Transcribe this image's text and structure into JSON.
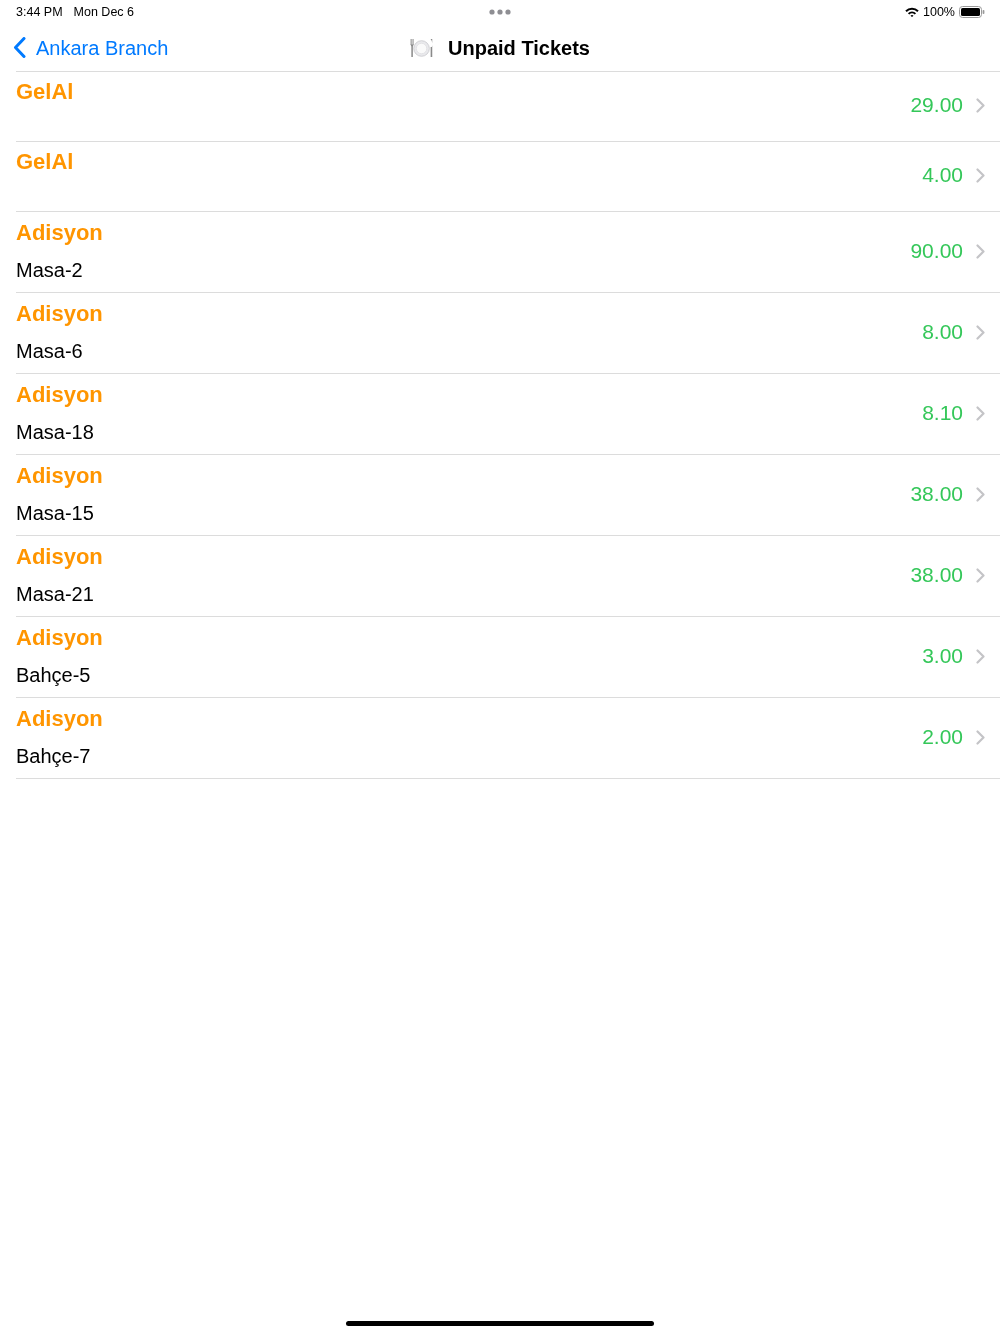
{
  "status_bar": {
    "time": "3:44 PM",
    "date": "Mon Dec 6",
    "battery": "100%"
  },
  "nav_bar": {
    "back_label": "Ankara Branch",
    "title": "Unpaid Tickets"
  },
  "tickets": [
    {
      "title": "GelAl",
      "amount": "29.00"
    },
    {
      "title": "GelAl",
      "amount": "4.00"
    },
    {
      "title": "Adisyon",
      "subtitle": "Masa-2",
      "amount": "90.00"
    },
    {
      "title": "Adisyon",
      "subtitle": "Masa-6",
      "amount": "8.00"
    },
    {
      "title": "Adisyon",
      "subtitle": "Masa-18",
      "amount": "8.10"
    },
    {
      "title": "Adisyon",
      "subtitle": "Masa-15",
      "amount": "38.00"
    },
    {
      "title": "Adisyon",
      "subtitle": "Masa-21",
      "amount": "38.00"
    },
    {
      "title": "Adisyon",
      "subtitle": "Bahçe-5",
      "amount": "3.00"
    },
    {
      "title": "Adisyon",
      "subtitle": "Bahçe-7",
      "amount": "2.00"
    }
  ]
}
